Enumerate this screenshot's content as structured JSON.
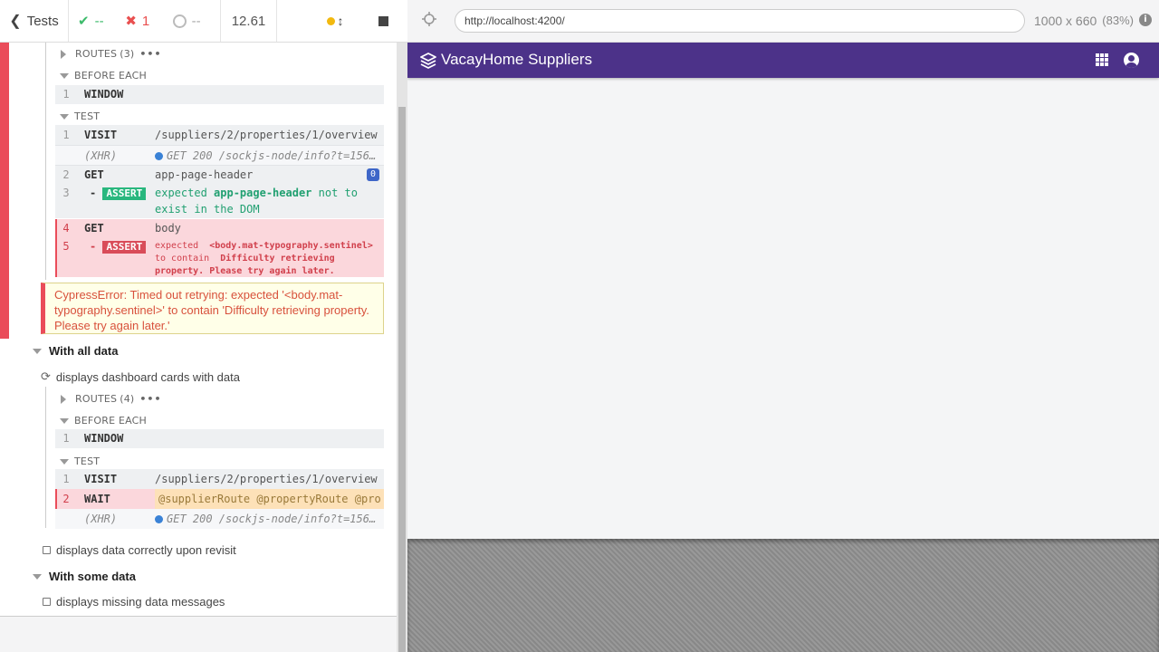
{
  "stats": {
    "back_label": "Tests",
    "passed": "--",
    "failed": "1",
    "pending": "--",
    "duration": "12.61"
  },
  "suite1": {
    "routes_label": "ROUTES",
    "routes_count": "(3)",
    "before_each_label": "BEFORE EACH",
    "before_cmds": [
      {
        "num": "1",
        "name": "WINDOW",
        "msg": ""
      }
    ],
    "test_label": "TEST",
    "test_cmds": [
      {
        "num": "1",
        "name": "VISIT",
        "msg": "/suppliers/2/properties/1/overview"
      },
      {
        "num": "",
        "name": "(XHR)",
        "msg": "GET 200 /sockjs-node/info?t=1561..."
      },
      {
        "num": "2",
        "name": "GET",
        "msg": "app-page-header",
        "badge": "0"
      },
      {
        "num": "3",
        "name": "ASSERT",
        "prefix": "expected",
        "subject": "app-page-header",
        "suffix": "not to exist in the DOM"
      },
      {
        "num": "4",
        "name": "GET",
        "msg": "body"
      },
      {
        "num": "5",
        "name": "ASSERT",
        "prefix": "expected",
        "subject": "<body.mat-typography.sentinel>",
        "mid": "to contain",
        "value": "Difficulty retrieving property. Please try again later."
      }
    ],
    "error": "CypressError: Timed out retrying: expected '<body.mat-typography.sentinel>' to contain 'Difficulty retrieving property. Please try again later.'"
  },
  "suite2": {
    "title": "With all data",
    "test_title": "displays dashboard cards with data",
    "routes_label": "ROUTES",
    "routes_count": "(4)",
    "before_each_label": "BEFORE EACH",
    "before_cmds": [
      {
        "num": "1",
        "name": "WINDOW",
        "msg": ""
      }
    ],
    "test_label": "TEST",
    "test_cmds": [
      {
        "num": "1",
        "name": "VISIT",
        "msg": "/suppliers/2/properties/1/overview"
      },
      {
        "num": "2",
        "name": "WAIT",
        "aliases": [
          "@supplierRoute",
          "@propertyRoute",
          "@pro"
        ]
      },
      {
        "num": "",
        "name": "(XHR)",
        "msg": "GET 200 /sockjs-node/info?t=1561..."
      }
    ],
    "test2_title": "displays data correctly upon revisit"
  },
  "suite3": {
    "title": "With some data",
    "test_title": "displays missing data messages"
  },
  "aut": {
    "url": "http://localhost:4200/",
    "viewport": "1000 x 660",
    "scale": "(83%)",
    "app_title_bold": "VacayHome",
    "app_title_rest": " Suppliers"
  },
  "colors": {
    "app_bar": "#4c3289",
    "fail": "#ea4c5a",
    "pass": "#3cbb6b"
  }
}
